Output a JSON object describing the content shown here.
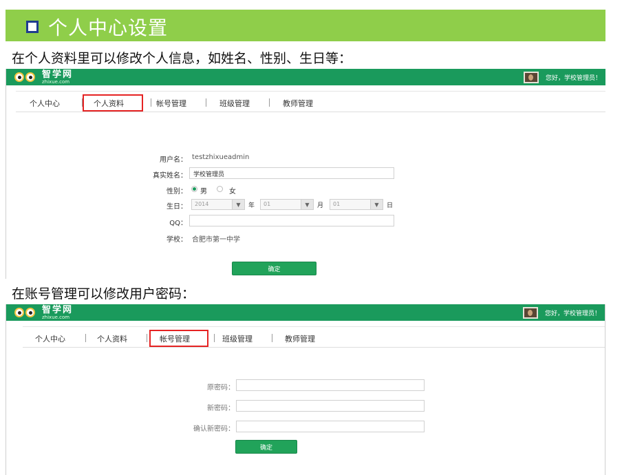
{
  "slide": {
    "title": "个人中心设置",
    "caption_profile": "在个人资料里可以修改个人信息，如姓名、性别、生日等：",
    "caption_account": "在账号管理可以修改用户密码："
  },
  "app": {
    "logo_cn": "智学网",
    "logo_en": "zhixue.com",
    "greeting": "您好，学校管理员！"
  },
  "tabs": [
    "个人中心",
    "个人资料",
    "帐号管理",
    "班级管理",
    "教师管理"
  ],
  "profile_form": {
    "username_label": "用户名：",
    "username_value": "testzhixueadmin",
    "realname_label": "真实姓名：",
    "realname_value": "学校管理员",
    "gender_label": "性别：",
    "gender_male": "男",
    "gender_female": "女",
    "gender_selected": "男",
    "birthday_label": "生日：",
    "year_value": "2014",
    "year_unit": "年",
    "month_value": "01",
    "month_unit": "月",
    "day_value": "01",
    "day_unit": "日",
    "qq_label": "QQ：",
    "qq_value": "",
    "school_label": "学校：",
    "school_value": "合肥市第一中学",
    "submit_label": "确定"
  },
  "password_form": {
    "old_label": "原密码：",
    "new_label": "新密码：",
    "confirm_label": "确认新密码：",
    "submit_label": "确定"
  },
  "colors": {
    "title_bar": "#8fce4a",
    "app_header": "#1a9a5c",
    "highlight_box": "#e52222",
    "button": "#21a35a"
  }
}
